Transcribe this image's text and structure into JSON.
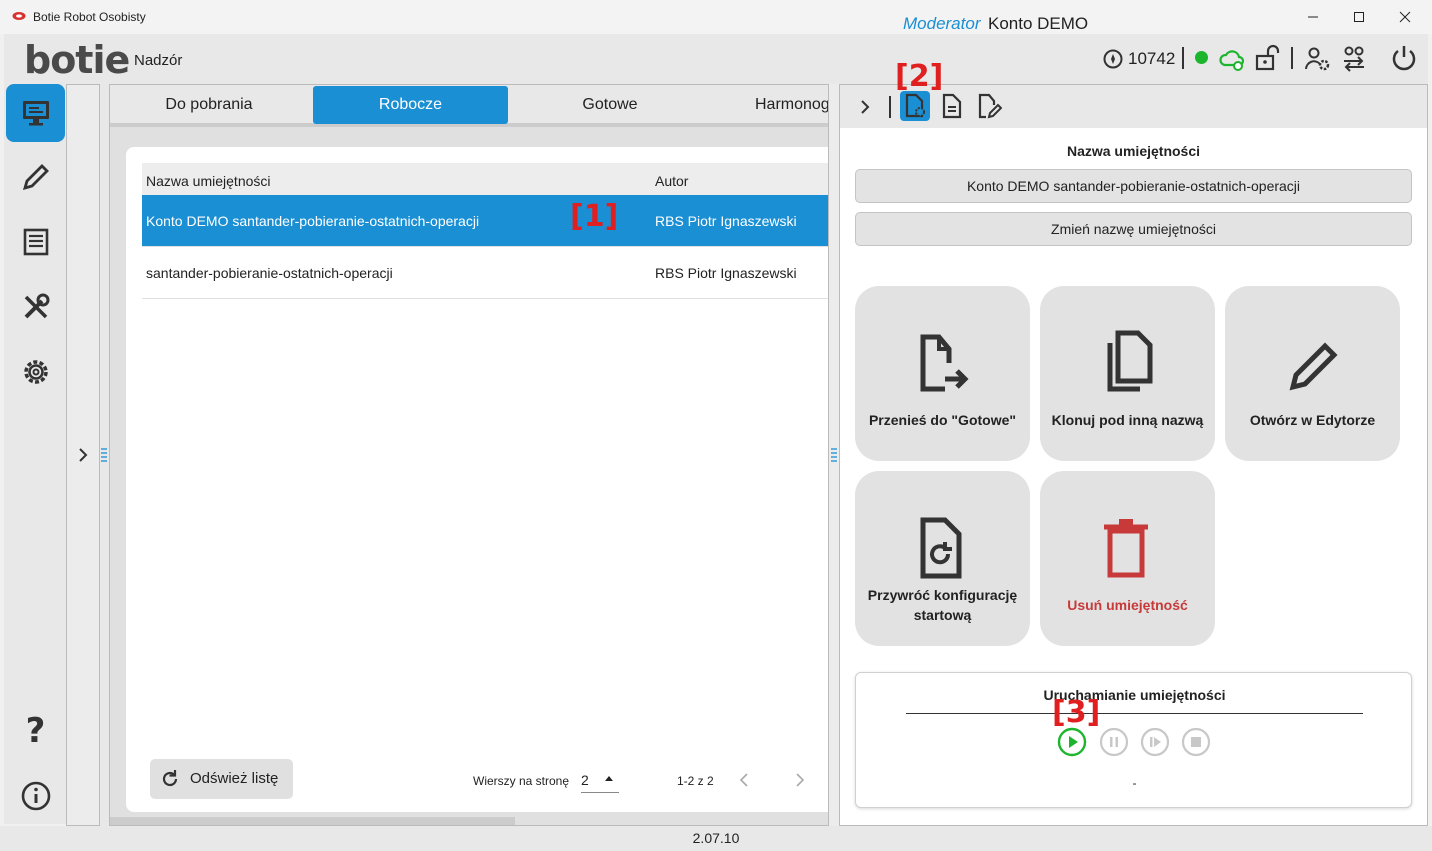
{
  "window": {
    "title": "Botie Robot Osobisty"
  },
  "header": {
    "logo": "botie",
    "page_label": "Nadzór",
    "role": "Moderator",
    "account": "Konto DEMO",
    "credits": "10742",
    "status_color": "#1db52e",
    "icons": [
      "credits-icon",
      "cloud-sync-icon",
      "unlock-icon",
      "user-settings-icon",
      "users-exchange-icon",
      "power-icon"
    ]
  },
  "nav": {
    "items": [
      "monitor-icon",
      "pencil-icon",
      "list-icon",
      "tools-icon",
      "gear-icon",
      "help-icon",
      "info-icon"
    ],
    "help_glyph": "?"
  },
  "tabs": [
    "Do pobrania",
    "Robocze",
    "Gotowe",
    "Harmonogram"
  ],
  "active_tab": "Robocze",
  "table": {
    "headers": [
      "Nazwa umiejętności",
      "Autor"
    ],
    "rows": [
      {
        "name": "Konto DEMO santander-pobieranie-ostatnich-operacji",
        "author": "RBS Piotr Ignaszewski",
        "selected": true
      },
      {
        "name": "santander-pobieranie-ostatnich-operacji",
        "author": "RBS Piotr Ignaszewski",
        "selected": false
      }
    ]
  },
  "markers": {
    "m1": "[1]",
    "m2": "[2]",
    "m3": "[3]"
  },
  "footer_controls": {
    "refresh_label": "Odśwież listę",
    "rows_per_page_label": "Wierszy na stronę",
    "rows_per_page_value": "2",
    "range": "1-2 z 2"
  },
  "right_panel": {
    "section_title": "Nazwa umiejętności",
    "skill_name": "Konto DEMO santander-pobieranie-ostatnich-operacji",
    "rename_label": "Zmień nazwę umiejętności",
    "tiles": [
      {
        "label": "Przenieś do \"Gotowe\"",
        "icon": "file-move-icon"
      },
      {
        "label": "Klonuj pod inną nazwą",
        "icon": "copy-icon"
      },
      {
        "label": "Otwórz w Edytorze",
        "icon": "pencil-icon"
      },
      {
        "label_line1": "Przywróć konfigurację",
        "label_line2": "startową",
        "icon": "file-restore-icon"
      },
      {
        "label": "Usuń umiejętność",
        "icon": "trash-icon",
        "color": "#c83a3a"
      }
    ],
    "run": {
      "title": "Uruchamianie umiejętności",
      "status": "-",
      "play_color": "#1db52e"
    }
  },
  "version": "2.07.10",
  "accent": "#1a8fd3"
}
